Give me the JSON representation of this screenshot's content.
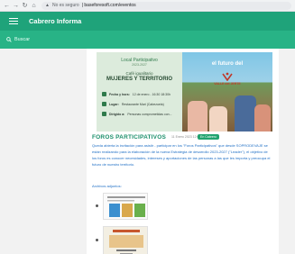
{
  "browser": {
    "back_icon": "back-arrow-icon",
    "forward_icon": "forward-arrow-icon",
    "reload_icon": "reload-icon",
    "home_icon": "home-icon",
    "security_label": "No es seguro",
    "url": "| baseforesoft.com/eventos"
  },
  "app": {
    "title": "Cabrero Informa",
    "search_placeholder": "Buscar",
    "header_color": "#1fa37a",
    "search_color": "#28b386"
  },
  "poster": {
    "heading": "Local Participativo",
    "year": "2023-2027",
    "subtitle": "Café igualitario",
    "headline": "MUJERES Y TERRITORIO",
    "rows": [
      {
        "label": "Fecha y hora:",
        "value": "12 de enero - 16:30 18:30h"
      },
      {
        "label": "Lugar:",
        "value": "Restaurante Mari (Cabezuela)"
      },
      {
        "label": "Dirigido a:",
        "value": "Personas comprometidas con..."
      }
    ],
    "right_title": "el futuro del",
    "logo_text": "VALLE del JERTE"
  },
  "event": {
    "title": "FOROS PARTICIPATIVOS",
    "date": "11 Enero 2023 12:00",
    "badge": "En Cabrero",
    "body": "Queda abierta la invitación para asistir - participar en los \"Foros Participativos\" que desde SOPRODEVAJE se están realizando para la elaboración de la nueva Estrategia de desarrollo 2023-2027 (\"Leader\"), el objetivo de los foros es conocer necesidades, intereses y aportaciones de las personas a las que les importa y preocupa el futuro de nuestro territorio.",
    "attachments_label": "Archivos adjuntos:"
  }
}
